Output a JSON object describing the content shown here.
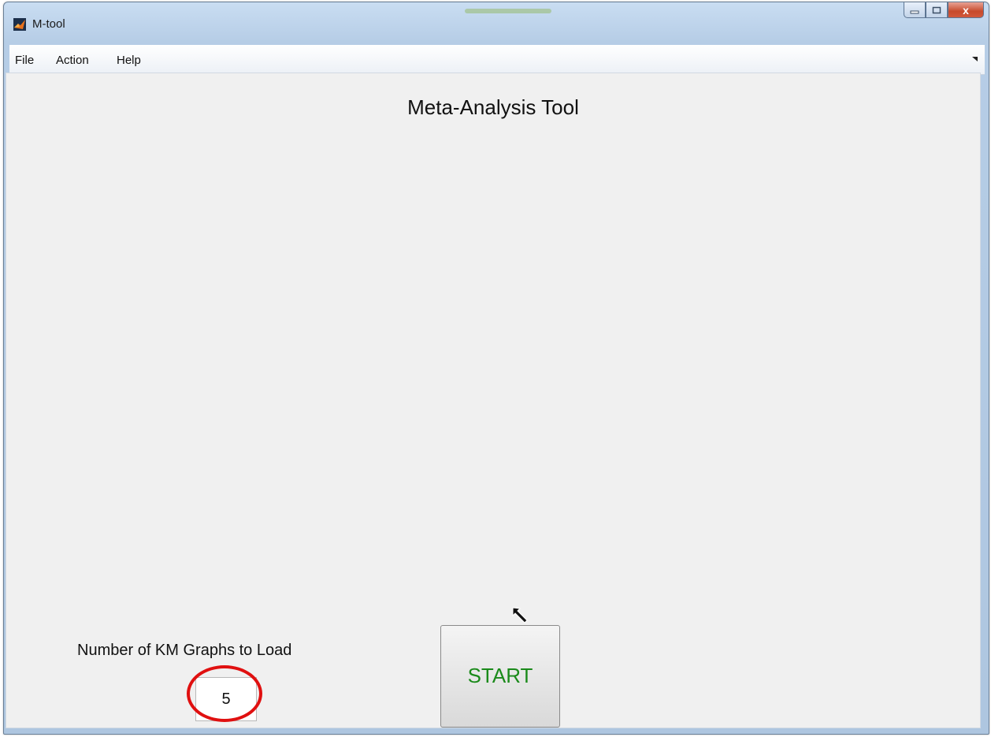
{
  "window": {
    "title": "M-tool",
    "close_glyph": "x"
  },
  "menu": {
    "items": [
      {
        "label": "File"
      },
      {
        "label": "Action"
      },
      {
        "label": "Help"
      }
    ]
  },
  "main": {
    "title": "Meta-Analysis Tool",
    "graph_count": {
      "label": "Number of  KM Graphs to Load",
      "value": "5"
    },
    "start_button": {
      "label": "START"
    }
  },
  "colors": {
    "start_text": "#1a8a1a",
    "highlight_ring": "#e01010",
    "content_background": "#f0f0f0"
  },
  "icons": {
    "app": "matlab-icon",
    "minimize": "minimize-icon",
    "maximize": "maximize-icon",
    "close": "close-icon",
    "toolbar_toggle": "menu-expand-arrow-icon",
    "cursor": "mouse-pointer-icon"
  }
}
